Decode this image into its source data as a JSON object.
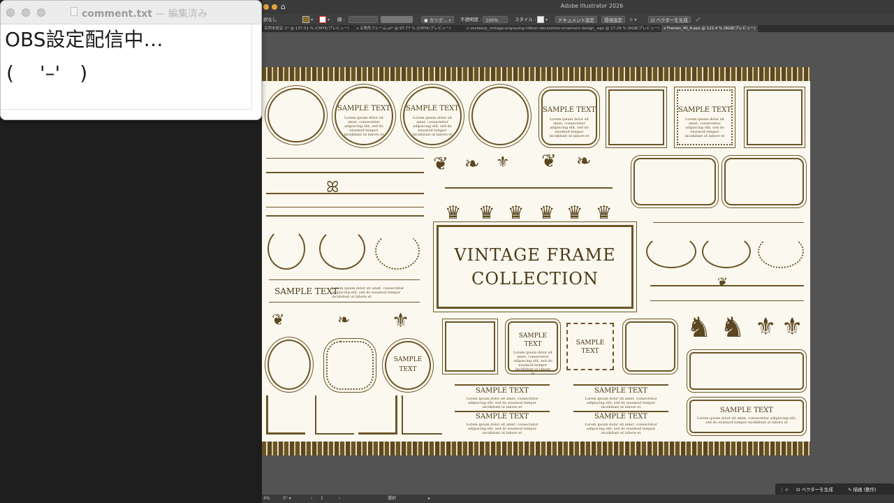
{
  "textedit": {
    "title_file": "comment.txt",
    "title_sep": " — ",
    "title_status": "編集済み",
    "lines": [
      "OBS設定配信中…",
      "(　 '–'　)"
    ]
  },
  "illustrator": {
    "app_title": "Adobe Illustrator 2026",
    "controlbar": {
      "selection": "択なし",
      "stroke_label": "線 :",
      "brush_name": "カリグ...",
      "opacity_label": "不透明度 :",
      "opacity_value": "100%",
      "style_label": "スタイル :",
      "document_setup": "ドキュメント設定",
      "preferences": "環境設定",
      "generate_vector": "ベクターを生成"
    },
    "tabs": [
      "名称未設定-1* @ 137.01 % (CMYK/プレビュー)",
      "x 五角形フレーム.ai* @ 97.77 % (CMYK/プレビュー)",
      "x vecteezy_vintage-engraving-ribbon-decorative-ornament-design_.eps @ 17.29 % (RGB/プレビュー)",
      "x Frames_40_A.eps @ 122.4 % (RGB/プレビュー)"
    ],
    "artwork": {
      "sample_text": "SAMPLE TEXT",
      "sample": "SAMPLE",
      "text": "TEXT",
      "title_line1": "VINTAGE FRAME",
      "title_line2": "COLLECTION",
      "lorem": "Lorem ipsum dolor sit amet, consectetur adipiscing elit, sed do eiusmod tempor incididunt ut labore et"
    },
    "statusbar": {
      "zoom": "4%",
      "page": "1",
      "tool": "選択"
    },
    "taskbar": {
      "generate_vector": "ベクターを生成",
      "draw_mode": "描画 (動作)"
    },
    "colors": {
      "ornament": "#6b5527",
      "artboard": "#fbf8ef",
      "app_bg": "#535353"
    }
  }
}
